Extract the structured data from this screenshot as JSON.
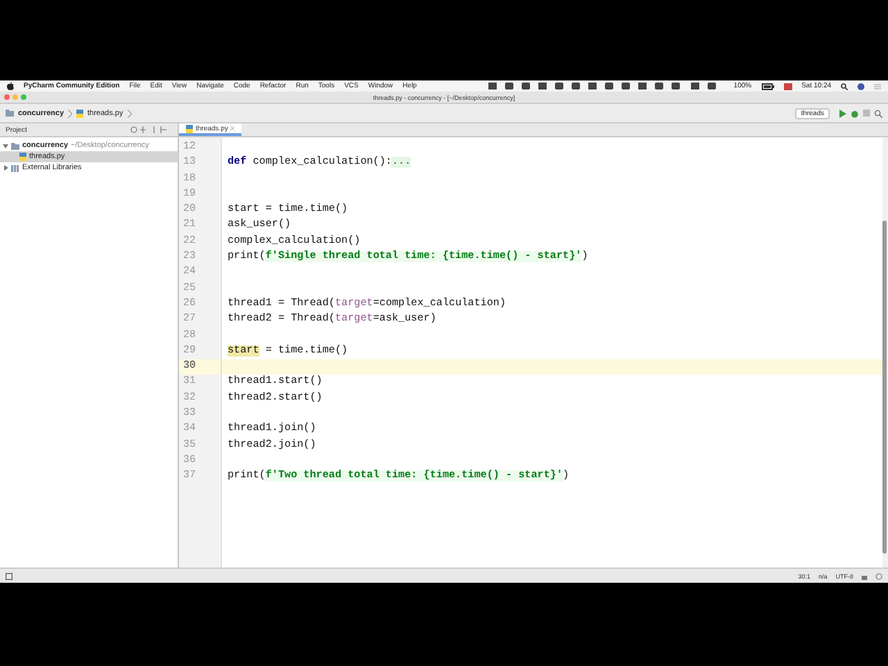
{
  "menu_bar": {
    "app": "PyCharm Community Edition",
    "items": [
      "File",
      "Edit",
      "View",
      "Navigate",
      "Code",
      "Refactor",
      "Run",
      "Tools",
      "VCS",
      "Window",
      "Help"
    ],
    "battery": "100%",
    "clock": "Sat 10:24"
  },
  "window": {
    "title": "threads.py - concurrency - [~/Desktop/concurrency]"
  },
  "breadcrumbs": [
    "concurrency",
    "threads.py"
  ],
  "run_config": "threads",
  "project_panel": {
    "title": "Project",
    "tree": [
      {
        "label": "concurrency",
        "path": "~/Desktop/concurrency",
        "kind": "folder",
        "expanded": true,
        "selected": false,
        "children": [
          {
            "label": "threads.py",
            "kind": "file",
            "selected": true
          }
        ]
      },
      {
        "label": "External Libraries",
        "kind": "library",
        "expanded": false,
        "selected": false
      }
    ]
  },
  "editor_tabs": [
    {
      "label": "threads.py",
      "selected": true
    }
  ],
  "code_lines": [
    {
      "number": "12",
      "current": false
    },
    {
      "number": "13",
      "current": false,
      "tokens": [
        {
          "text": "def",
          "kind": "keyword"
        },
        {
          "text": " complex_calculation():",
          "kind": "plain"
        },
        {
          "text": "...",
          "kind": "fold"
        }
      ]
    },
    {
      "number": "18",
      "current": false
    },
    {
      "number": "19",
      "current": false
    },
    {
      "number": "20",
      "current": false,
      "tokens": [
        {
          "text": "start = time.time()",
          "kind": "plain"
        }
      ]
    },
    {
      "number": "21",
      "current": false,
      "tokens": [
        {
          "text": "ask_user()",
          "kind": "plain"
        }
      ]
    },
    {
      "number": "22",
      "current": false,
      "tokens": [
        {
          "text": "complex_calculation()",
          "kind": "plain"
        }
      ]
    },
    {
      "number": "23",
      "current": false,
      "tokens": [
        {
          "text": "print(",
          "kind": "plain"
        },
        {
          "text": "f'Single thread total time: {time.time() - start}'",
          "kind": "string"
        },
        {
          "text": ")",
          "kind": "plain"
        }
      ]
    },
    {
      "number": "24",
      "current": false
    },
    {
      "number": "25",
      "current": false
    },
    {
      "number": "26",
      "current": false,
      "tokens": [
        {
          "text": "thread1 = Thread(",
          "kind": "plain"
        },
        {
          "text": "target",
          "kind": "param"
        },
        {
          "text": "=complex_calculation)",
          "kind": "plain"
        }
      ]
    },
    {
      "number": "27",
      "current": false,
      "tokens": [
        {
          "text": "thread2 = Thread(",
          "kind": "plain"
        },
        {
          "text": "target",
          "kind": "param"
        },
        {
          "text": "=ask_user)",
          "kind": "plain"
        }
      ]
    },
    {
      "number": "28",
      "current": false
    },
    {
      "number": "29",
      "current": false,
      "tokens": [
        {
          "text": "start",
          "kind": "usage"
        },
        {
          "text": " = time.time()",
          "kind": "plain"
        }
      ]
    },
    {
      "number": "30",
      "current": true
    },
    {
      "number": "31",
      "current": false,
      "tokens": [
        {
          "text": "thread1.start()",
          "kind": "plain"
        }
      ]
    },
    {
      "number": "32",
      "current": false,
      "tokens": [
        {
          "text": "thread2.start()",
          "kind": "plain"
        }
      ]
    },
    {
      "number": "33",
      "current": false
    },
    {
      "number": "34",
      "current": false,
      "tokens": [
        {
          "text": "thread1.join()",
          "kind": "plain"
        }
      ]
    },
    {
      "number": "35",
      "current": false,
      "tokens": [
        {
          "text": "thread2.join()",
          "kind": "plain"
        }
      ]
    },
    {
      "number": "36",
      "current": false
    },
    {
      "number": "37",
      "current": false,
      "tokens": [
        {
          "text": "print(",
          "kind": "plain"
        },
        {
          "text": "f'Two thread total time: {time.time() - start}'",
          "kind": "string"
        },
        {
          "text": ")",
          "kind": "plain"
        }
      ]
    }
  ],
  "status_bar": {
    "position": "30:1",
    "separator": "n/a",
    "encoding": "UTF-8"
  }
}
